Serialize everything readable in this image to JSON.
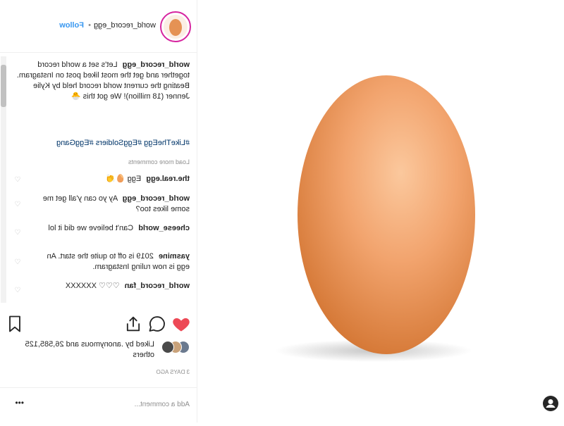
{
  "header": {
    "username": "world_record_egg",
    "separator": "•",
    "follow_label": "Follow"
  },
  "caption": {
    "username": "world_record_egg",
    "text": "Let's set a world record together and get the most liked post on Instagram. Beating the current world record held by Kylie Jenner (18 million)! We got this 🐣",
    "hashtags": "#LikeTheEgg #EggSoldiers #EggGang"
  },
  "comments_section": {
    "load_more_label": "Load more comments"
  },
  "comments": [
    {
      "user": "the.real.egg",
      "text": "Egg 🥚👏"
    },
    {
      "user": "world_record_egg",
      "text": "Ay yo can y'all get me some likes too?"
    },
    {
      "user": "cheese_world",
      "text": "Can't believe we did it lol"
    },
    {
      "user": "yasmine",
      "text": "2019 is off to quite the start. An egg is now ruling Instagram."
    },
    {
      "user": "world_record_fan",
      "text": "♡♡♡ XXXXXX"
    }
  ],
  "likes": {
    "text": "Liked by .anonymous and 26,585,125 others"
  },
  "timestamp": "3 DAYS AGO",
  "add_comment": {
    "placeholder": "Add a comment...",
    "more_label": "•••"
  },
  "colors": {
    "heart": "#ed4956",
    "link": "#3897f0",
    "hashtag": "#003569",
    "egg_light": "#f6b887",
    "egg_dark": "#d97a3a"
  },
  "icons": [
    "heart-icon",
    "comment-icon",
    "share-icon",
    "bookmark-icon",
    "user-icon",
    "chevron-icon"
  ]
}
